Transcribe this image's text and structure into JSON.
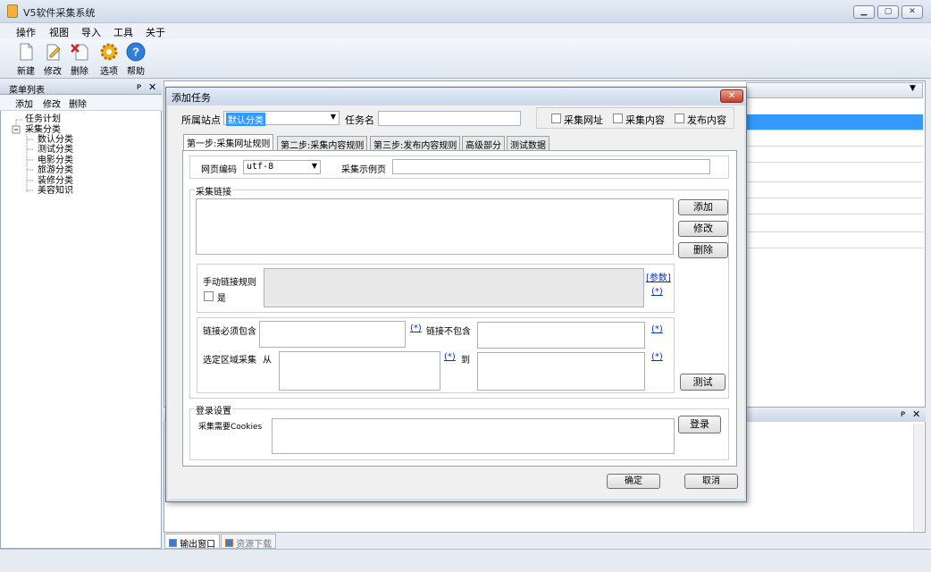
{
  "app": {
    "title": "V5软件采集系统",
    "menu": [
      "操作",
      "视图",
      "导入",
      "工具",
      "关于"
    ],
    "toolbar": {
      "new": "新建",
      "edit": "修改",
      "delete": "删除",
      "options": "选项",
      "help": "帮助"
    }
  },
  "left_panel": {
    "title": "菜单列表",
    "pin": "ᴘ",
    "close": "✕",
    "actions": {
      "add": "添加",
      "edit": "修改",
      "delete": "删除"
    },
    "tree": {
      "task_plan": "任务计划",
      "collect_category": "采集分类",
      "children": [
        "数认分类",
        "测试分类",
        "电影分类",
        "旅游分类",
        "装修分类",
        "美容知识"
      ]
    }
  },
  "bottom_panel": {
    "tab_output": "输出窗口",
    "tab_download": "资源下载"
  },
  "dialog": {
    "title": "添加任务",
    "close": "✕",
    "site_label": "所属站点",
    "site_value": "默认分类",
    "task_name_label": "任务名",
    "task_name_value": "",
    "chk_collect_url": "采集网址",
    "chk_collect_content": "采集内容",
    "chk_publish_content": "发布内容",
    "tabs": [
      "第一步:采集网址规则",
      "第二步:采集内容规则",
      "第三步:发布内容规则",
      "高级部分",
      "测试数据"
    ],
    "encoding_label": "网页编码",
    "encoding_value": "utf-8",
    "sample_page_label": "采集示例页",
    "sample_page_value": "",
    "links_group": "采集链接",
    "btn_add": "添加",
    "btn_edit": "修改",
    "btn_delete": "删除",
    "manual_rule_label": "手动链接规则",
    "param_link": "[参数]",
    "star_link": "(*)",
    "yes_label": "是",
    "must_contain_label": "链接必须包含",
    "not_contain_label": "链接不包含",
    "region_label": "选定区域采集",
    "from_label": "从",
    "to_label": "到",
    "btn_test": "测试",
    "login_group": "登录设置",
    "cookies_label": "采集需要Cookies",
    "btn_login": "登录",
    "btn_ok": "确定",
    "btn_cancel": "取消"
  }
}
